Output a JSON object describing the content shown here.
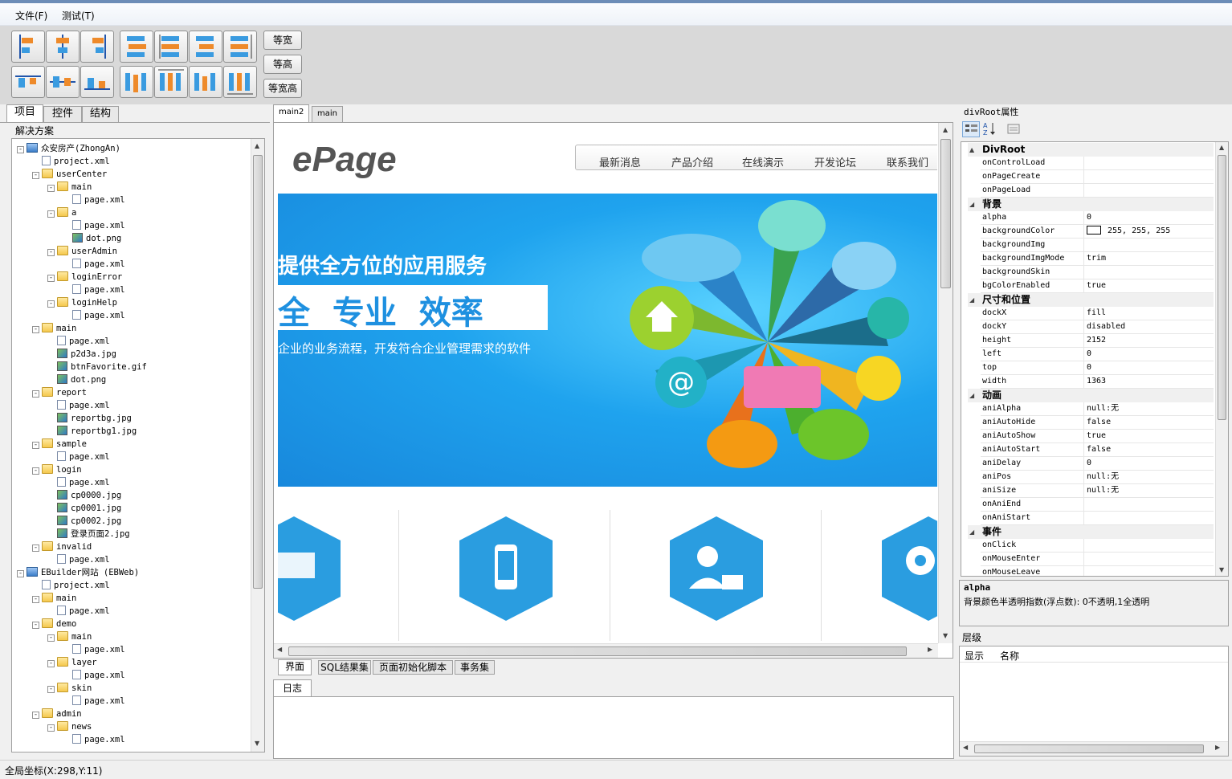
{
  "menu": {
    "file": "文件(F)",
    "test": "测试(T)"
  },
  "toolbar": {
    "equal_width": "等宽",
    "equal_height": "等高",
    "equal_both": "等宽高"
  },
  "left_tabs": {
    "project": "项目",
    "controls": "控件",
    "structure": "结构"
  },
  "solution_label": "解决方案",
  "tree": [
    {
      "label": "众安房产(ZhongAn)",
      "icon": "project",
      "level": 0,
      "exp": "-"
    },
    {
      "label": "project.xml",
      "icon": "file",
      "level": 1
    },
    {
      "label": "userCenter",
      "icon": "folder",
      "level": 1,
      "exp": "-"
    },
    {
      "label": "main",
      "icon": "folder",
      "level": 2,
      "exp": "-"
    },
    {
      "label": "page.xml",
      "icon": "file",
      "level": 3
    },
    {
      "label": "a",
      "icon": "folder",
      "level": 2,
      "exp": "-"
    },
    {
      "label": "page.xml",
      "icon": "file",
      "level": 3
    },
    {
      "label": "dot.png",
      "icon": "image",
      "level": 3
    },
    {
      "label": "userAdmin",
      "icon": "folder",
      "level": 2,
      "exp": "-"
    },
    {
      "label": "page.xml",
      "icon": "file",
      "level": 3
    },
    {
      "label": "loginError",
      "icon": "folder",
      "level": 2,
      "exp": "-"
    },
    {
      "label": "page.xml",
      "icon": "file",
      "level": 3
    },
    {
      "label": "loginHelp",
      "icon": "folder",
      "level": 2,
      "exp": "-"
    },
    {
      "label": "page.xml",
      "icon": "file",
      "level": 3
    },
    {
      "label": "main",
      "icon": "folder",
      "level": 1,
      "exp": "-"
    },
    {
      "label": "page.xml",
      "icon": "file",
      "level": 2
    },
    {
      "label": "p2d3a.jpg",
      "icon": "image",
      "level": 2
    },
    {
      "label": "btnFavorite.gif",
      "icon": "image",
      "level": 2
    },
    {
      "label": "dot.png",
      "icon": "image",
      "level": 2
    },
    {
      "label": "report",
      "icon": "folder",
      "level": 1,
      "exp": "-"
    },
    {
      "label": "page.xml",
      "icon": "file",
      "level": 2
    },
    {
      "label": "reportbg.jpg",
      "icon": "image",
      "level": 2
    },
    {
      "label": "reportbg1.jpg",
      "icon": "image",
      "level": 2
    },
    {
      "label": "sample",
      "icon": "folder",
      "level": 1,
      "exp": "-"
    },
    {
      "label": "page.xml",
      "icon": "file",
      "level": 2
    },
    {
      "label": "login",
      "icon": "folder",
      "level": 1,
      "exp": "-"
    },
    {
      "label": "page.xml",
      "icon": "file",
      "level": 2
    },
    {
      "label": "cp0000.jpg",
      "icon": "image",
      "level": 2
    },
    {
      "label": "cp0001.jpg",
      "icon": "image",
      "level": 2
    },
    {
      "label": "cp0002.jpg",
      "icon": "image",
      "level": 2
    },
    {
      "label": "登录页面2.jpg",
      "icon": "image",
      "level": 2
    },
    {
      "label": "invalid",
      "icon": "folder",
      "level": 1,
      "exp": "-"
    },
    {
      "label": "page.xml",
      "icon": "file",
      "level": 2
    },
    {
      "label": "EBuilder网站 (EBWeb)",
      "icon": "project",
      "level": 0,
      "exp": "-"
    },
    {
      "label": "project.xml",
      "icon": "file",
      "level": 1
    },
    {
      "label": "main",
      "icon": "folder",
      "level": 1,
      "exp": "-"
    },
    {
      "label": "page.xml",
      "icon": "file",
      "level": 2
    },
    {
      "label": "demo",
      "icon": "folder",
      "level": 1,
      "exp": "-"
    },
    {
      "label": "main",
      "icon": "folder",
      "level": 2,
      "exp": "-"
    },
    {
      "label": "page.xml",
      "icon": "file",
      "level": 3
    },
    {
      "label": "layer",
      "icon": "folder",
      "level": 2,
      "exp": "-"
    },
    {
      "label": "page.xml",
      "icon": "file",
      "level": 3
    },
    {
      "label": "skin",
      "icon": "folder",
      "level": 2,
      "exp": "-"
    },
    {
      "label": "page.xml",
      "icon": "file",
      "level": 3
    },
    {
      "label": "admin",
      "icon": "folder",
      "level": 1,
      "exp": "-"
    },
    {
      "label": "news",
      "icon": "folder",
      "level": 2,
      "exp": "-"
    },
    {
      "label": "page.xml",
      "icon": "file",
      "level": 3
    }
  ],
  "doc_tabs": {
    "main2": "main2",
    "main": "main"
  },
  "preview": {
    "logo": "ePage",
    "nav": [
      "最新消息",
      "产品介绍",
      "在线演示",
      "开发论坛",
      "联系我们"
    ],
    "banner_line1": "提供全方位的应用服务",
    "banner_line2": "全  专业  效率",
    "banner_line3": "企业的业务流程，开发符合企业管理需求的软件"
  },
  "bottom_tabs": {
    "ui": "界面",
    "sql": "SQL结果集",
    "init": "页面初始化脚本",
    "trans": "事务集"
  },
  "log_tab": "日志",
  "props": {
    "title": "divRoot属性",
    "rows": [
      {
        "cat": "DivRoot",
        "expander": "▲"
      },
      {
        "name": "onControlLoad",
        "value": ""
      },
      {
        "name": "onPageCreate",
        "value": ""
      },
      {
        "name": "onPageLoad",
        "value": ""
      },
      {
        "cat": "背景",
        "expander": "◢"
      },
      {
        "name": "alpha",
        "value": "0"
      },
      {
        "name": "backgroundColor",
        "value": "255, 255, 255",
        "swatch": "#ffffff"
      },
      {
        "name": "backgroundImg",
        "value": ""
      },
      {
        "name": "backgroundImgMode",
        "value": "trim"
      },
      {
        "name": "backgroundSkin",
        "value": ""
      },
      {
        "name": "bgColorEnabled",
        "value": "true"
      },
      {
        "cat": "尺寸和位置",
        "expander": "◢"
      },
      {
        "name": "dockX",
        "value": "fill"
      },
      {
        "name": "dockY",
        "value": "disabled"
      },
      {
        "name": "height",
        "value": "2152"
      },
      {
        "name": "left",
        "value": "0"
      },
      {
        "name": "top",
        "value": "0"
      },
      {
        "name": "width",
        "value": "1363"
      },
      {
        "cat": "动画",
        "expander": "◢"
      },
      {
        "name": "aniAlpha",
        "value": "null:无"
      },
      {
        "name": "aniAutoHide",
        "value": "false"
      },
      {
        "name": "aniAutoShow",
        "value": "true"
      },
      {
        "name": "aniAutoStart",
        "value": "false"
      },
      {
        "name": "aniDelay",
        "value": "0"
      },
      {
        "name": "aniPos",
        "value": "null:无"
      },
      {
        "name": "aniSize",
        "value": "null:无"
      },
      {
        "name": "onAniEnd",
        "value": ""
      },
      {
        "name": "onAniStart",
        "value": ""
      },
      {
        "cat": "事件",
        "expander": "◢"
      },
      {
        "name": "onClick",
        "value": ""
      },
      {
        "name": "onMouseEnter",
        "value": ""
      },
      {
        "name": "onMouseLeave",
        "value": ""
      }
    ],
    "desc_name": "alpha",
    "desc_text": "背景颜色半透明指数(浮点数): 0不透明,1全透明"
  },
  "layers": {
    "title": "层级",
    "col_show": "显示",
    "col_name": "名称"
  },
  "status": "全局坐标(X:298,Y:11)"
}
